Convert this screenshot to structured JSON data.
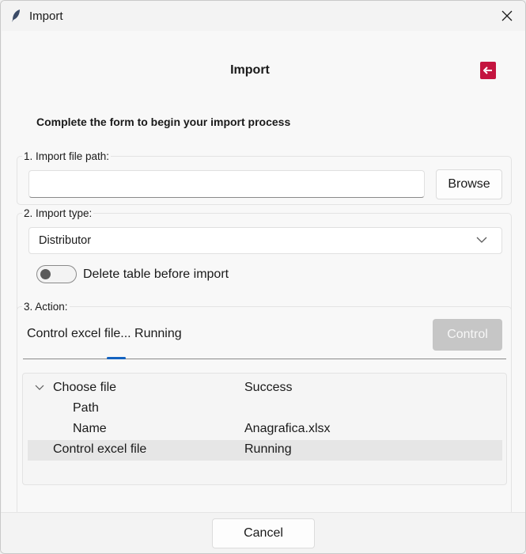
{
  "window": {
    "title": "Import"
  },
  "header": {
    "title": "Import"
  },
  "subtitle": "Complete the form to begin your import process",
  "section1": {
    "label": "1. Import file path:",
    "path_value": "",
    "browse_label": "Browse"
  },
  "section2": {
    "label": "2. Import type:",
    "selected_type": "Distributor",
    "toggle_label": "Delete table before import",
    "toggle_on": false
  },
  "section3": {
    "label": "3. Action:",
    "status": "Control excel file... Running",
    "control_label": "Control",
    "tree": [
      {
        "name": "Choose file",
        "value": "Success"
      },
      {
        "name": "Path",
        "value": ""
      },
      {
        "name": "Name",
        "value": "Anagrafica.xlsx"
      },
      {
        "name": "Control excel file",
        "value": "Running"
      }
    ]
  },
  "footer": {
    "cancel_label": "Cancel"
  },
  "colors": {
    "exit_button": "#c4143f",
    "progress": "#1463c0",
    "disabled_button": "#c6c6c6"
  }
}
